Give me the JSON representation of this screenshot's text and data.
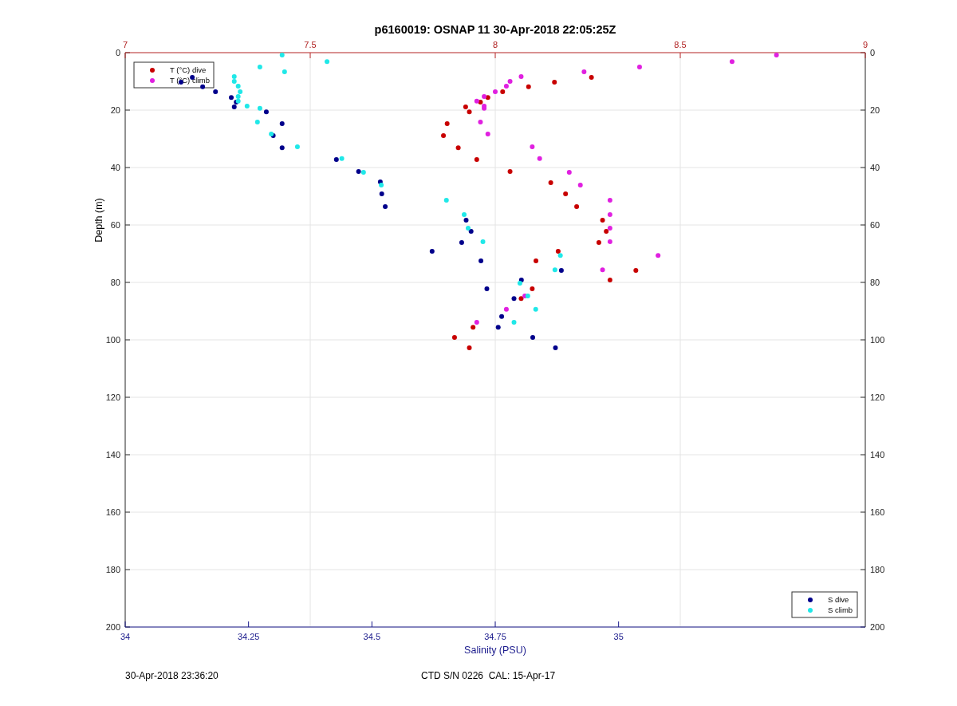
{
  "figure": {
    "chart_data": {
      "type": "scatter",
      "x2lim": [
        7,
        9
      ],
      "x2ticks": [
        7,
        7.5,
        8,
        8.5,
        9
      ],
      "y2lim": [
        200,
        0
      ],
      "y2ticks": [
        0,
        20,
        40,
        60,
        80,
        100,
        120,
        140,
        160,
        180,
        200
      ],
      "grid": true,
      "legend": true,
      "title": "p6160019: OSNAP 11 30-Apr-2018 22:05:25Z",
      "xlabel": "Salinity (PSU)",
      "ylabel": "Depth (m)",
      "xlim": [
        34,
        35.5
      ],
      "ylim": [
        200,
        0
      ],
      "xticks": [
        34,
        34.25,
        34.5,
        34.75,
        35
      ],
      "yticks": [
        0,
        20,
        40,
        60,
        80,
        100,
        120,
        140,
        160,
        180,
        200
      ],
      "series": [
        {
          "name": "T (°C) dive",
          "color": "#c80000",
          "axis": "x2",
          "x": [
            8.26,
            8.16,
            8.09,
            8.02,
            7.98,
            7.96,
            7.92,
            7.93,
            7.87,
            7.86,
            7.9,
            7.95,
            8.04,
            8.15,
            8.19,
            8.22,
            8.29,
            8.3,
            8.28,
            8.17,
            8.11,
            8.38,
            8.31,
            8.1,
            8.07,
            7.94,
            7.89,
            7.93
          ],
          "values": [
            8.6,
            10.3,
            11.9,
            13.6,
            15.6,
            17.2,
            18.9,
            20.6,
            24.7,
            28.9,
            33.1,
            37.2,
            41.4,
            45.3,
            49.2,
            53.6,
            58.3,
            62.2,
            66.1,
            69.2,
            72.5,
            75.8,
            79.2,
            82.2,
            85.6,
            95.6,
            99.2,
            102.8
          ]
        },
        {
          "name": "T (°C) climb",
          "color": "#e020e0",
          "axis": "x2",
          "x": [
            8.76,
            8.64,
            8.39,
            8.24,
            8.07,
            8.04,
            8.03,
            8.0,
            7.97,
            7.95,
            7.97,
            7.97,
            7.96,
            7.98,
            8.1,
            8.12,
            8.2,
            8.23,
            8.31,
            8.31,
            8.31,
            8.31,
            8.44,
            8.29,
            8.08,
            8.03,
            7.95
          ],
          "values": [
            0.8,
            3.1,
            5.0,
            6.7,
            8.3,
            10.0,
            11.7,
            13.6,
            15.3,
            16.9,
            18.6,
            19.4,
            24.2,
            28.3,
            32.8,
            36.9,
            41.7,
            46.1,
            51.4,
            56.4,
            61.1,
            65.8,
            70.6,
            75.6,
            84.7,
            89.4,
            93.9
          ]
        },
        {
          "name": "S dive",
          "color": "#00008b",
          "x": [
            34.113,
            34.136,
            34.157,
            34.183,
            34.215,
            34.225,
            34.221,
            34.286,
            34.318,
            34.3,
            34.318,
            34.428,
            34.473,
            34.517,
            34.52,
            34.527,
            34.691,
            34.701,
            34.682,
            34.622,
            34.721,
            34.884,
            34.803,
            34.733,
            34.788,
            34.763,
            34.756,
            34.826,
            34.872
          ],
          "values": [
            10.3,
            8.6,
            11.9,
            13.6,
            15.6,
            17.2,
            18.9,
            20.6,
            24.7,
            28.9,
            33.1,
            37.2,
            41.4,
            45.0,
            49.2,
            53.6,
            58.3,
            62.2,
            66.1,
            69.2,
            72.5,
            75.8,
            79.2,
            82.2,
            85.6,
            91.9,
            95.6,
            99.2,
            102.8
          ]
        },
        {
          "name": "S climb",
          "color": "#20e8e8",
          "x": [
            34.318,
            34.409,
            34.273,
            34.323,
            34.221,
            34.221,
            34.229,
            34.233,
            34.229,
            34.229,
            34.247,
            34.273,
            34.268,
            34.296,
            34.349,
            34.439,
            34.483,
            34.519,
            34.651,
            34.687,
            34.695,
            34.725,
            34.882,
            34.871,
            34.8,
            34.816,
            34.832,
            34.788
          ],
          "values": [
            0.8,
            3.1,
            5.0,
            6.7,
            8.3,
            10.0,
            11.7,
            13.6,
            15.3,
            16.9,
            18.6,
            19.4,
            24.2,
            28.3,
            32.8,
            36.9,
            41.7,
            46.1,
            51.4,
            56.4,
            61.1,
            65.8,
            70.6,
            75.6,
            80.3,
            84.7,
            89.4,
            93.9
          ]
        }
      ]
    },
    "footer": [
      "30-Apr-2018 23:36:20",
      "CTD S/N 0226  CAL: 15-Apr-17"
    ]
  }
}
